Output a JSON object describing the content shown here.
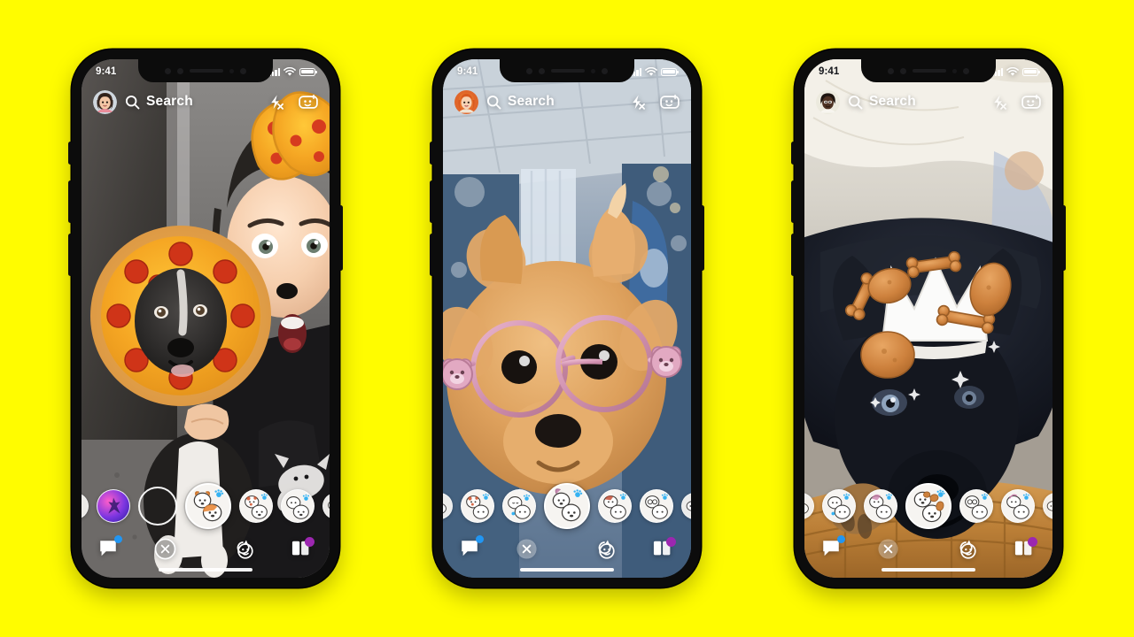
{
  "scene": {
    "background_color": "#FFFC00",
    "device_count": 3,
    "app": "Snapchat"
  },
  "phones": [
    {
      "id": "phone-left",
      "status_bar": {
        "time": "9:41",
        "signal": "signal-bars-icon",
        "wifi": "wifi-icon",
        "battery": "battery-full-icon"
      },
      "header": {
        "avatar": "bitmoji-avatar-dark-hair-female",
        "search_icon": "search-icon",
        "search_label": "Search",
        "flash_icon": "flash-off-icon",
        "camera_flip_icon": "camera-flip-icon"
      },
      "camera": {
        "scene_description": "woman with pizza dog-ear lens holding a pepperoni pizza in front of a black and white dog",
        "lens_name": "pizza-dog-ears-lens"
      },
      "carousel": {
        "lenses": [
          {
            "name": "lens-partial-left",
            "type": "partial"
          },
          {
            "name": "lens-neon-dancer",
            "type": "neon"
          },
          {
            "name": "shutter-button",
            "type": "shutter"
          },
          {
            "name": "lens-two-dogs-paw",
            "type": "selected"
          },
          {
            "name": "lens-dalmatian-paw",
            "type": "normal"
          },
          {
            "name": "lens-puppy-paw",
            "type": "normal"
          },
          {
            "name": "lens-partial-right",
            "type": "partial"
          }
        ]
      },
      "toolbar": {
        "chat_icon": "chat-bubble-icon",
        "chat_badge_color": "#2196f3",
        "close_icon": "close-circle-icon",
        "memories_icon": "memories-smiley-icon",
        "stories_icon": "stories-cards-icon",
        "stories_badge_color": "#9c27b0"
      },
      "home_indicator": "home-indicator"
    },
    {
      "id": "phone-center",
      "status_bar": {
        "time": "9:41",
        "signal": "signal-bars-icon",
        "wifi": "wifi-icon",
        "battery": "battery-full-icon"
      },
      "header": {
        "avatar": "bitmoji-avatar-red-hair-female",
        "search_icon": "search-icon",
        "search_label": "Search",
        "flash_icon": "flash-off-icon",
        "camera_flip_icon": "camera-flip-icon"
      },
      "camera": {
        "scene_description": "pomeranian dog wearing pink round glasses with teddy bear charms in a blue room",
        "lens_name": "pink-bear-glasses-lens"
      },
      "carousel": {
        "lenses": [
          {
            "name": "lens-partial-left",
            "type": "partial"
          },
          {
            "name": "lens-dalmatian-paw",
            "type": "normal"
          },
          {
            "name": "lens-sleepy-dog-paw",
            "type": "normal"
          },
          {
            "name": "lens-two-dogs-paw",
            "type": "selected"
          },
          {
            "name": "lens-dog-bandana-paw",
            "type": "normal"
          },
          {
            "name": "lens-glasses-dog-paw",
            "type": "normal"
          },
          {
            "name": "lens-partial-right",
            "type": "partial"
          }
        ]
      },
      "toolbar": {
        "chat_icon": "chat-bubble-icon",
        "chat_badge_color": "#2196f3",
        "close_icon": "close-circle-icon",
        "memories_icon": "memories-smiley-icon",
        "stories_icon": "stories-cards-icon",
        "stories_badge_color": "#9c27b0"
      },
      "home_indicator": "home-indicator"
    },
    {
      "id": "phone-right",
      "status_bar": {
        "time": "9:41",
        "signal": "signal-bars-icon",
        "wifi": "wifi-icon",
        "battery": "battery-full-icon"
      },
      "header": {
        "avatar": "bitmoji-avatar-dark-skin-male",
        "search_icon": "search-icon",
        "search_label": "Search",
        "flash_icon": "flash-off-icon",
        "camera_flip_icon": "camera-flip-icon"
      },
      "camera": {
        "scene_description": "black german shepherd puppy lying on a dog bed wearing a crown of dog treats and bones",
        "lens_name": "dog-treat-crown-lens"
      },
      "carousel": {
        "lenses": [
          {
            "name": "lens-partial-left",
            "type": "partial"
          },
          {
            "name": "lens-puppy-paw",
            "type": "normal"
          },
          {
            "name": "lens-dog-bandana-paw",
            "type": "normal"
          },
          {
            "name": "lens-treats-dog-paw",
            "type": "selected"
          },
          {
            "name": "lens-glasses-dog-paw",
            "type": "normal"
          },
          {
            "name": "lens-two-dogs-paw",
            "type": "normal"
          },
          {
            "name": "lens-partial-right",
            "type": "partial"
          }
        ]
      },
      "toolbar": {
        "chat_icon": "chat-bubble-icon",
        "chat_badge_color": "#2196f3",
        "close_icon": "close-circle-icon",
        "memories_icon": "memories-smiley-icon",
        "stories_icon": "stories-cards-icon",
        "stories_badge_color": "#9c27b0"
      },
      "home_indicator": "home-indicator"
    }
  ]
}
